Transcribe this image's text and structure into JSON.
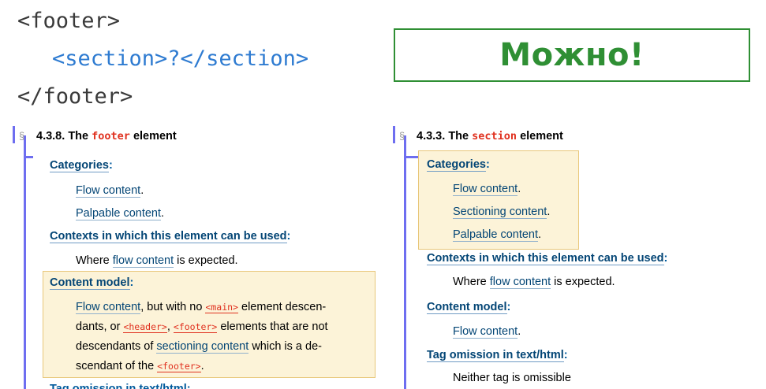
{
  "code": {
    "line1": "<footer>",
    "line2": "<section>?</section>",
    "line3": "</footer>"
  },
  "verdict": "Можно!",
  "left": {
    "para_sign": "§",
    "section_number": "4.3.8.",
    "title_prefix": "The",
    "element": "footer",
    "title_suffix": "element",
    "categories_label": "Categories",
    "categories": [
      "Flow content",
      "Palpable content"
    ],
    "contexts_label": "Contexts in which this element can be used",
    "contexts_pre": "Where",
    "contexts_link": "flow content",
    "contexts_post": "is expected.",
    "content_model_label": "Content model",
    "cm": {
      "link1": "Flow content",
      "t1": ", but with no",
      "code1": "<main>",
      "t2": "element descen-",
      "t3": "dants, or",
      "code2": "<header>",
      "t4": ",",
      "code3": "<footer>",
      "t5": "elements that are not",
      "t6": "descendants of",
      "link2": "sectioning content",
      "t7": "which is a de-",
      "t8": "scendant of the",
      "code4": "<footer>",
      "t9": "."
    },
    "cut_off_label": "Tag omission in text/html:"
  },
  "right": {
    "para_sign": "§",
    "section_number": "4.3.3.",
    "title_prefix": "The",
    "element": "section",
    "title_suffix": "element",
    "categories_label": "Categories",
    "categories": [
      "Flow content",
      "Sectioning content",
      "Palpable content"
    ],
    "contexts_label": "Contexts in which this element can be used",
    "contexts_pre": "Where",
    "contexts_link": "flow content",
    "contexts_post": "is expected.",
    "content_model_label": "Content model",
    "content_model_value": "Flow content",
    "tag_omission_label": "Tag omission in text/html",
    "tag_omission_value": "Neither tag is omissible"
  },
  "colors": {
    "verdict_green": "#2f8f34",
    "code_blue": "#2e7bd1",
    "element_red": "#e0301e",
    "link_blue": "#034575",
    "term_blue": "#005a9c",
    "highlight_fill": "#fcf3d8",
    "highlight_border": "#e8c77a",
    "sidebar_bar": "#6e6ef0"
  }
}
